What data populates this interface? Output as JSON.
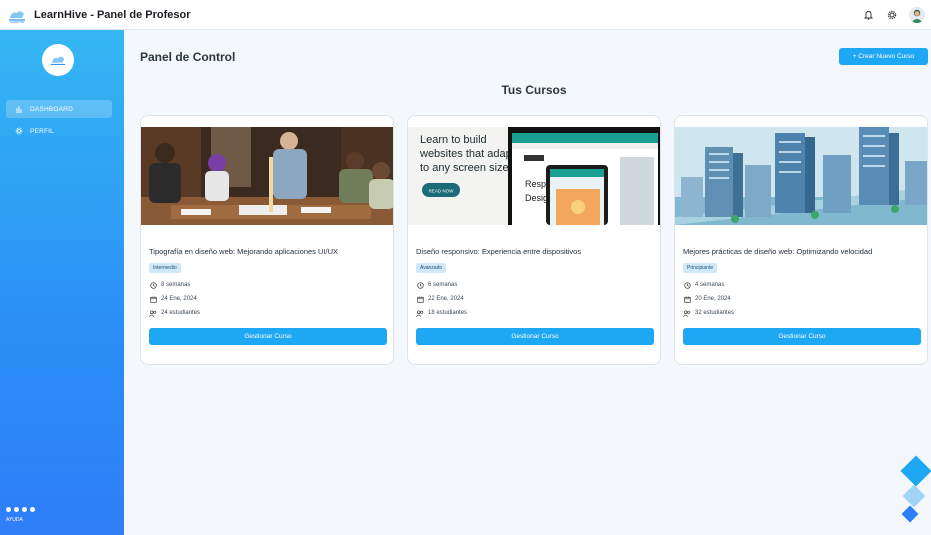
{
  "header": {
    "title": "LearnHive - Panel de Profesor",
    "icons": [
      "bell-icon",
      "gear-icon",
      "user-avatar"
    ]
  },
  "sidebar": {
    "logo": "learnhive-logo",
    "items": [
      {
        "label": "DASHBOARD",
        "icon": "bar-chart-icon",
        "active": true
      },
      {
        "label": "PERFIL",
        "icon": "gear-icon",
        "active": false
      }
    ],
    "help_label": "AYUDA"
  },
  "main": {
    "title": "Panel de Control",
    "create_button": "+ Crear Nuevo Curso",
    "section_title": "Tus Cursos"
  },
  "courses": [
    {
      "title": "Tipografía en diseño web: Mejorando aplicaciones UI/UX",
      "level": "Intermedio",
      "duration": "8 semanas",
      "date": "24 Ene, 2024",
      "students": "24 estudiantes",
      "button": "Gestionar Curso",
      "image": "classroom-photo"
    },
    {
      "title": "Diseño responsivo: Experiencia entre dispositivos",
      "level": "Avanzado",
      "duration": "6 semanas",
      "date": "22 Ene, 2024",
      "students": "18 estudiantes",
      "button": "Gestionar Curso",
      "image": "responsive-design-banner",
      "image_text": "Learn to build websites that adapt to any screen size",
      "image_button": "READ NOW"
    },
    {
      "title": "Mejores prácticas de diseño web: Optimizando velocidad",
      "level": "Principiante",
      "duration": "4 semanas",
      "date": "20 Ene, 2024",
      "students": "32 estudiantes",
      "button": "Gestionar Curso",
      "image": "isometric-city-illustration"
    }
  ],
  "colors": {
    "accent": "#1ea7f2",
    "sidebar_top": "#35b7f3",
    "sidebar_bottom": "#2f7ef8",
    "badge_bg": "#cfe9fb"
  }
}
